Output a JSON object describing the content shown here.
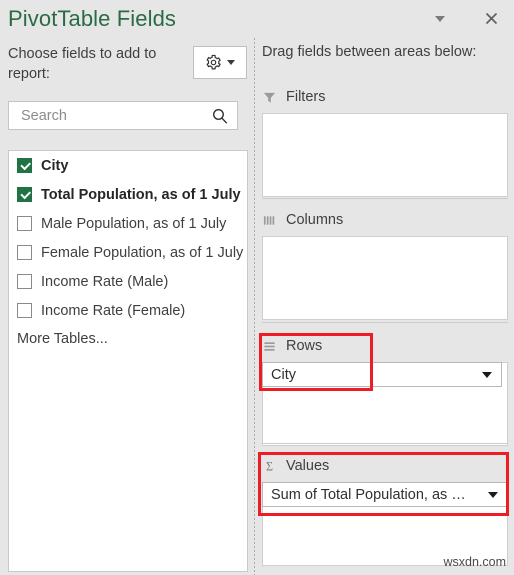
{
  "header": {
    "title": "PivotTable Fields",
    "dropdown_icon": "chevron-down-icon",
    "close_icon": "close-icon"
  },
  "left_panel": {
    "choose_label": "Choose fields to add to report:",
    "options_button": {
      "icon": "gear-icon",
      "caret_icon": "chevron-down-icon"
    },
    "search": {
      "placeholder": "Search",
      "value": "",
      "icon": "search-icon"
    },
    "fields": [
      {
        "label": "City",
        "checked": true
      },
      {
        "label": "Total Population, as of 1 July",
        "checked": true
      },
      {
        "label": "Male Population, as of 1 July",
        "checked": false
      },
      {
        "label": "Female Population, as of 1 July",
        "checked": false
      },
      {
        "label": "Income Rate (Male)",
        "checked": false
      },
      {
        "label": "Income Rate (Female)",
        "checked": false
      }
    ],
    "more_tables": "More Tables..."
  },
  "right_panel": {
    "instruction": "Drag fields between areas below:",
    "areas": {
      "filters": {
        "title": "Filters",
        "icon": "filter-funnel-icon",
        "items": []
      },
      "columns": {
        "title": "Columns",
        "icon": "columns-icon",
        "items": []
      },
      "rows": {
        "title": "Rows",
        "icon": "rows-icon",
        "items": [
          {
            "label": "City",
            "caret_icon": "chevron-down-icon"
          }
        ]
      },
      "values": {
        "title": "Values",
        "icon": "sigma-icon",
        "items": [
          {
            "label": "Sum of Total Population, as …",
            "caret_icon": "chevron-down-icon"
          }
        ]
      }
    }
  },
  "annotations": {
    "color": "#ee1c25",
    "boxes": [
      "rows-area-highlight",
      "values-area-highlight"
    ]
  },
  "watermark": "wsxdn.com"
}
